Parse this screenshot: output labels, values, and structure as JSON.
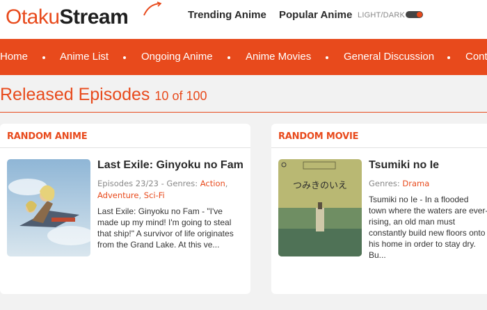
{
  "header": {
    "logo_part1": "Otaku",
    "logo_part2": "Stream",
    "links": {
      "trending": "Trending Anime",
      "popular": "Popular Anime"
    },
    "theme_toggle_label": "LIGHT/DARK"
  },
  "nav": {
    "items": [
      "Home",
      "Anime List",
      "Ongoing Anime",
      "Anime Movies",
      "General Discussion",
      "Cont"
    ]
  },
  "section": {
    "title": "Released Episodes",
    "count": "10 of 100"
  },
  "random_anime": {
    "header": "RANDOM ANIME",
    "title": "Last Exile: Ginyoku no Fam",
    "episodes_label": "Episodes 23/23 - Genres:",
    "genres": [
      "Action",
      "Adventure",
      "Sci-Fi"
    ],
    "sep1": ", ",
    "sep2": ", ",
    "description": "Last Exile: Ginyoku no Fam - \"I've made up my mind! I'm going to steal that ship!\" A survivor of life originates from the Grand Lake. At this ve..."
  },
  "random_movie": {
    "header": "RANDOM MOVIE",
    "title": "Tsumiki no Ie",
    "genres_label": "Genres:",
    "genres": [
      "Drama"
    ],
    "description": "Tsumiki no Ie - In a flooded town where the waters are ever-rising, an old man must constantly build new floors onto his home in order to stay dry. Bu...",
    "poster_text": "つみきのいえ"
  },
  "colors": {
    "accent": "#e84a1c",
    "background": "#f2f2f2",
    "card": "#ffffff"
  }
}
